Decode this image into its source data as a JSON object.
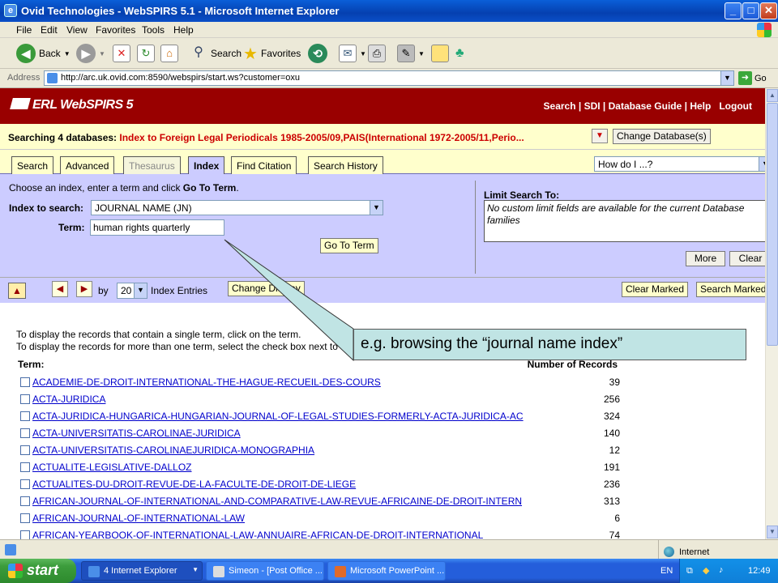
{
  "window": {
    "title": "Ovid Technologies - WebSPIRS 5.1 - Microsoft Internet Explorer",
    "min": "_",
    "max": "□",
    "close": "✕"
  },
  "menu": [
    "File",
    "Edit",
    "View",
    "Favorites",
    "Tools",
    "Help"
  ],
  "toolbar": {
    "back": "Back",
    "search": "Search",
    "favorites": "Favorites"
  },
  "address": {
    "label": "Address",
    "url": "http://arc.uk.ovid.com:8590/webspirs/start.ws?customer=oxu",
    "go": "Go"
  },
  "app": {
    "logo": "ERL WebSPIRS 5",
    "nav": "Search | SDI | Database Guide | Help   Logout",
    "db_prefix": "Searching 4 databases: ",
    "db_list": "Index to Foreign Legal Periodicals 1985-2005/09,PAIS(International 1972-2005/11,Perio...",
    "change_db": "Change Database(s)",
    "tabs": [
      "Search",
      "Advanced",
      "Thesaurus",
      "Index",
      "Find Citation",
      "Search History"
    ],
    "how_do_i": "How do I ...?"
  },
  "form": {
    "instruction_pre": "Choose an index, enter a term and click ",
    "instruction_bold": "Go To Term",
    "instruction_post": ".",
    "index_label": "Index to search:",
    "index_value": "JOURNAL NAME (JN)",
    "term_label": "Term:",
    "term_value": "human rights quarterly",
    "go_button": "Go To Term",
    "limit_title": "Limit Search To:",
    "limit_text": "No custom limit fields are available for the current Database families",
    "more": "More",
    "clear": "Clear"
  },
  "browse": {
    "by": "by",
    "count": "20",
    "entries": "Index Entries",
    "change_display": "Change Display",
    "clear_marked": "Clear Marked",
    "search_marked": "Search Marked"
  },
  "results": {
    "instr1": "To display the records that contain a single term, click on the term.",
    "instr2": "To display the records for more than one term, select the check box next to",
    "col_term": "Term:",
    "col_count": "Number of Records",
    "rows": [
      {
        "term": "ACADEMIE-DE-DROIT-INTERNATIONAL-THE-HAGUE-RECUEIL-DES-COURS",
        "count": "39"
      },
      {
        "term": "ACTA-JURIDICA",
        "count": "256"
      },
      {
        "term": "ACTA-JURIDICA-HUNGARICA-HUNGARIAN-JOURNAL-OF-LEGAL-STUDIES-FORMERLY-ACTA-JURIDICA-AC",
        "count": "324"
      },
      {
        "term": "ACTA-UNIVERSITATIS-CAROLINAE-JURIDICA",
        "count": "140"
      },
      {
        "term": "ACTA-UNIVERSITATIS-CAROLINAEJURIDICA-MONOGRAPHIA",
        "count": "12"
      },
      {
        "term": "ACTUALITE-LEGISLATIVE-DALLOZ",
        "count": "191"
      },
      {
        "term": "ACTUALITES-DU-DROIT-REVUE-DE-LA-FACULTE-DE-DROIT-DE-LIEGE",
        "count": "236"
      },
      {
        "term": "AFRICAN-JOURNAL-OF-INTERNATIONAL-AND-COMPARATIVE-LAW-REVUE-AFRICAINE-DE-DROIT-INTERN",
        "count": "313"
      },
      {
        "term": "AFRICAN-JOURNAL-OF-INTERNATIONAL-LAW",
        "count": "6"
      },
      {
        "term": "AFRICAN-YEARBOOK-OF-INTERNATIONAL-LAW-ANNUAIRE-AFRICAN-DE-DROIT-INTERNATIONAL",
        "count": "74"
      }
    ]
  },
  "callout": "e.g. browsing the “journal name index”",
  "status": {
    "zone": "Internet"
  },
  "taskbar": {
    "start": "start",
    "tasks": [
      "4 Internet Explorer",
      "Simeon - [Post Office ...",
      "Microsoft PowerPoint ..."
    ],
    "lang": "EN",
    "time": "12:49"
  },
  "colors": {
    "header": "#990000",
    "panel": "#ccccff",
    "dbbar": "#ffffcc",
    "callout": "#c0e4e4",
    "link": "#0000cc"
  }
}
